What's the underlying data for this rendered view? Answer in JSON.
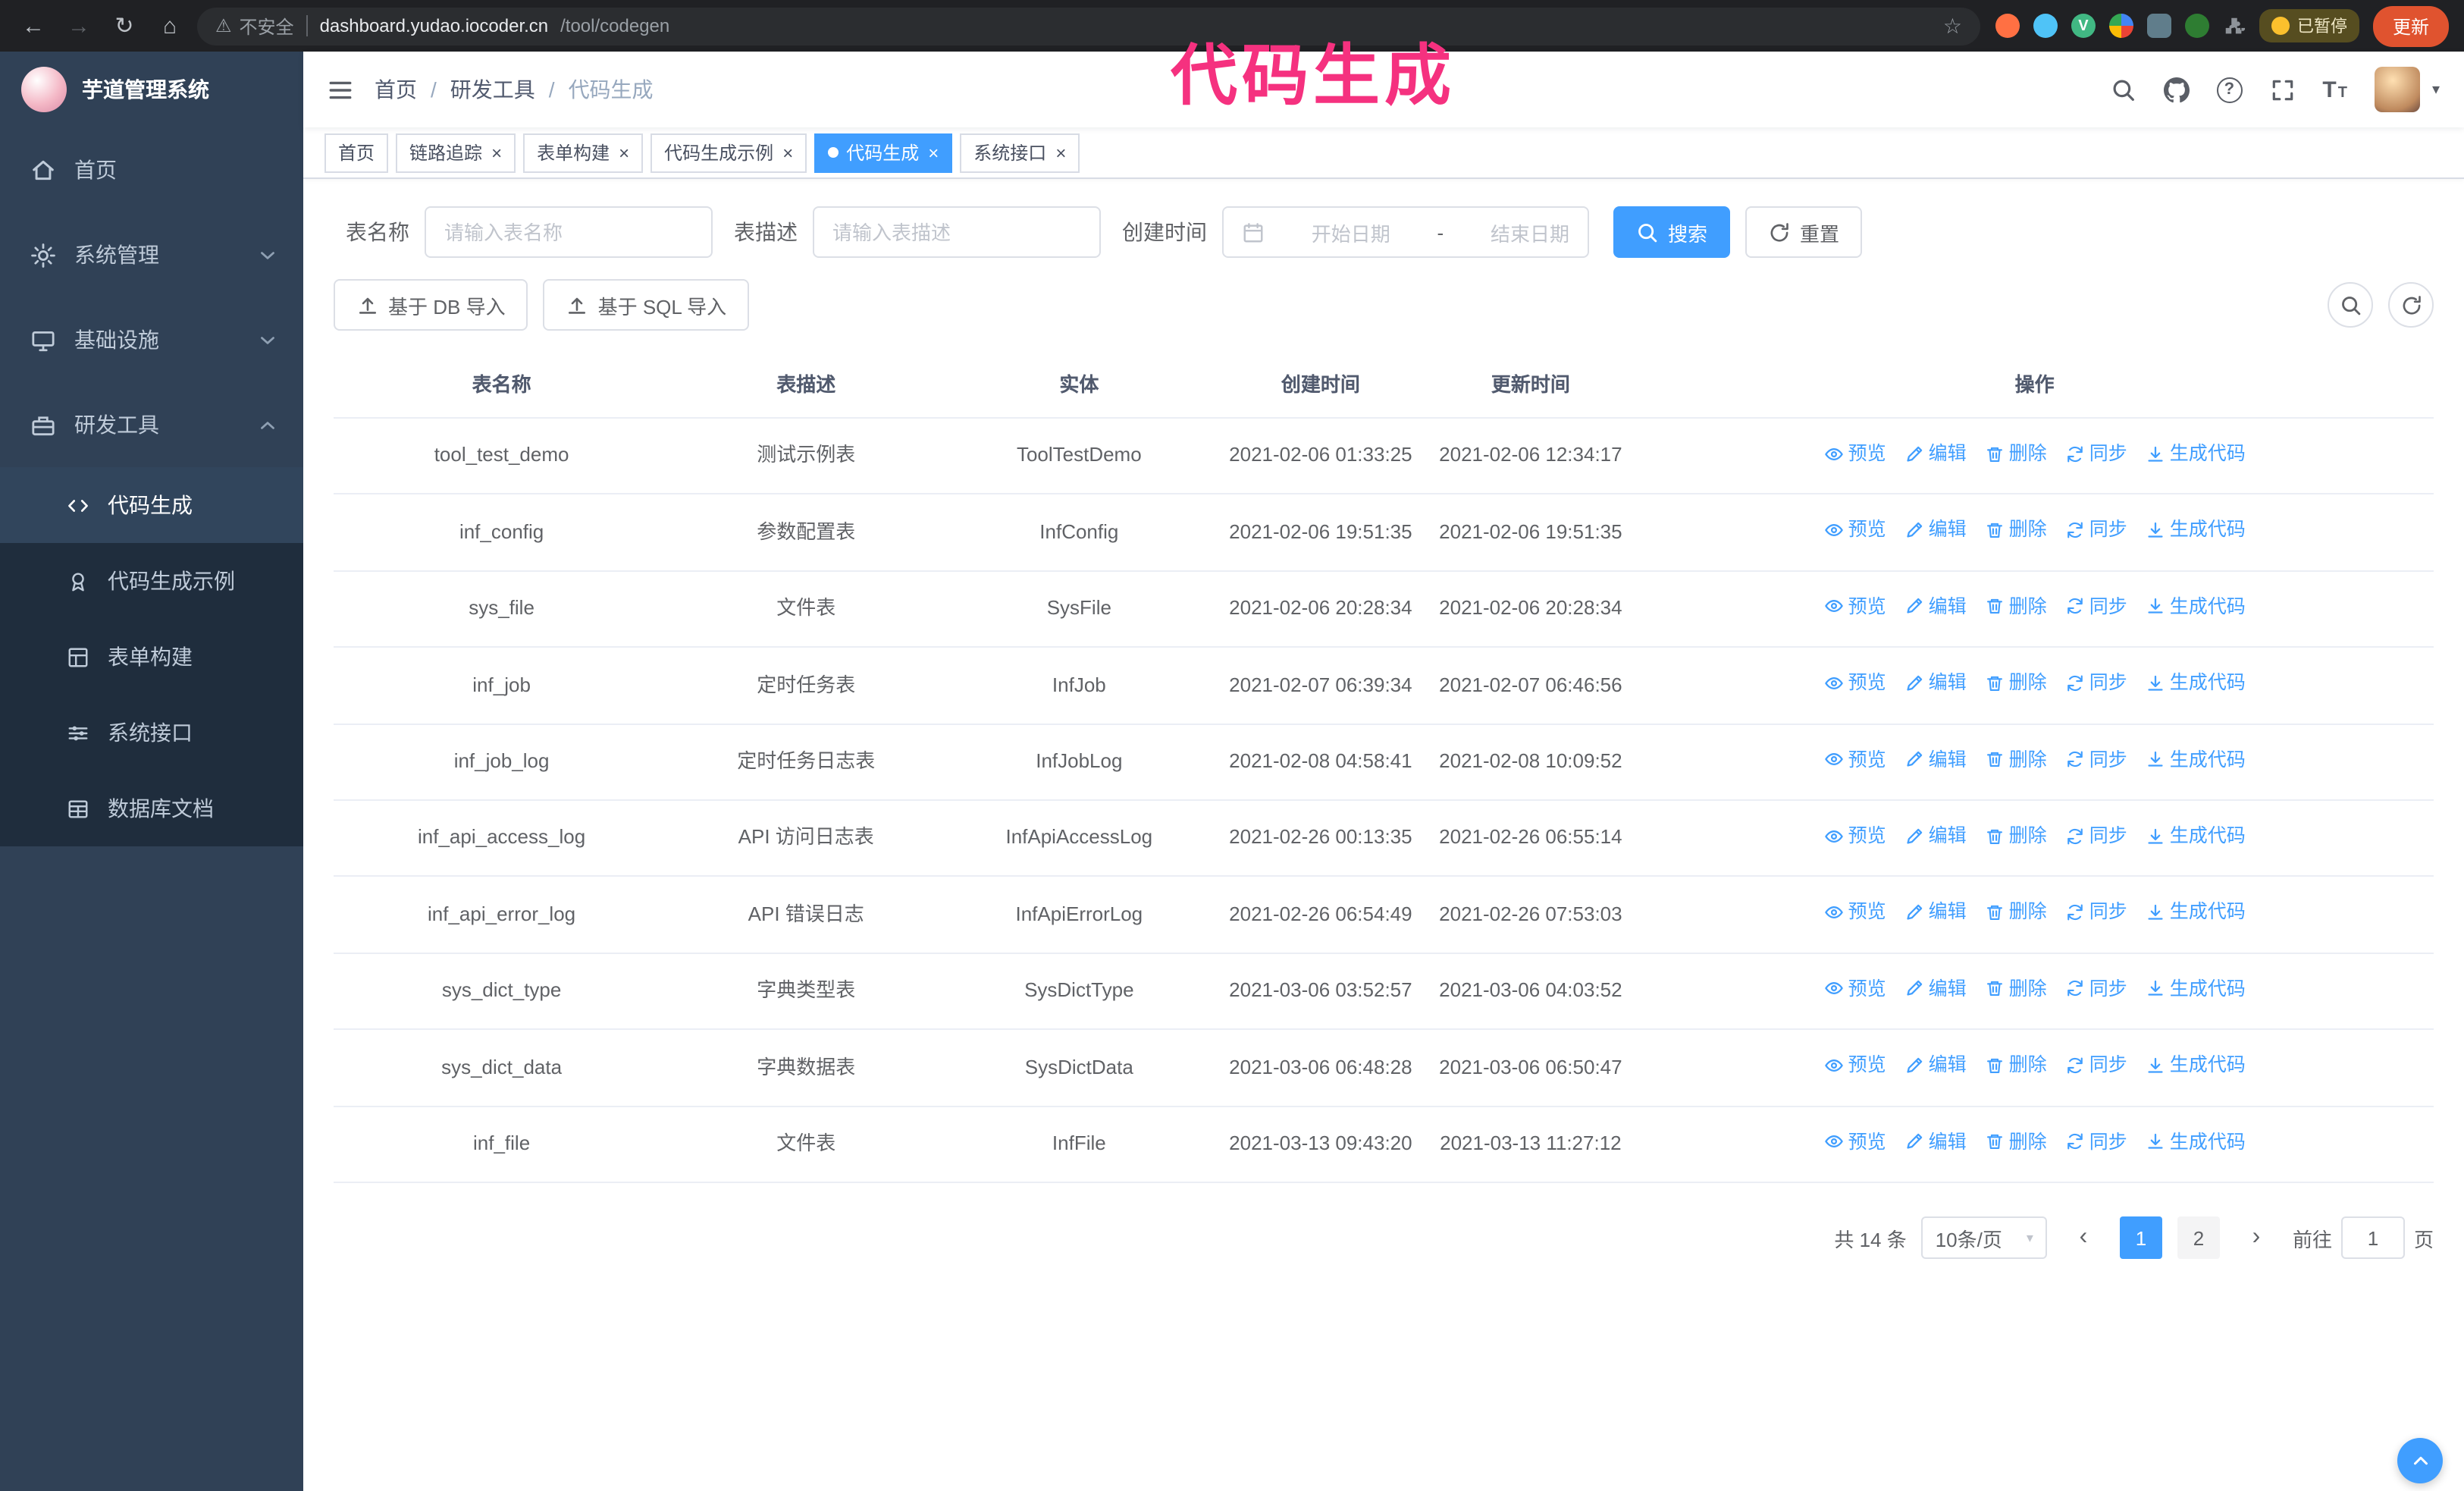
{
  "colors": {
    "accent": "#409eff",
    "annotation": "#f5317f",
    "sidebar_bg": "#304156",
    "submenu_bg": "#1f2d3d",
    "update_btn": "#e0532f"
  },
  "icons": {
    "back": "←",
    "forward": "→",
    "reload": "↻",
    "home": "⌂",
    "warning": "⚠",
    "star": "☆",
    "close": "×",
    "caret_down": "▾",
    "slash": "/",
    "prev": "‹",
    "next": "›",
    "text": "T",
    "question": "?"
  },
  "annotation": {
    "text": "代码生成"
  },
  "browser": {
    "warning": "不安全",
    "url_host": "dashboard.yudao.iocoder.cn",
    "url_path": "/tool/codegen",
    "vue_badge": "V",
    "paused_badge": "已暂停",
    "update_button": "更新"
  },
  "sidebar": {
    "title": "芋道管理系统",
    "menu": [
      {
        "label": "首页"
      },
      {
        "label": "系统管理"
      },
      {
        "label": "基础设施"
      },
      {
        "label": "研发工具"
      }
    ],
    "submenu": [
      {
        "label": "代码生成"
      },
      {
        "label": "代码生成示例"
      },
      {
        "label": "表单构建"
      },
      {
        "label": "系统接口"
      },
      {
        "label": "数据库文档"
      }
    ]
  },
  "header": {
    "breadcrumb": [
      "首页",
      "研发工具",
      "代码生成"
    ]
  },
  "tabs": [
    {
      "label": "首页"
    },
    {
      "label": "链路追踪"
    },
    {
      "label": "表单构建"
    },
    {
      "label": "代码生成示例"
    },
    {
      "label": "代码生成"
    },
    {
      "label": "系统接口"
    }
  ],
  "filters": {
    "table_name_label": "表名称",
    "table_name_placeholder": "请输入表名称",
    "table_desc_label": "表描述",
    "table_desc_placeholder": "请输入表描述",
    "create_time_label": "创建时间",
    "start_placeholder": "开始日期",
    "range_separator": "-",
    "end_placeholder": "结束日期",
    "search_button": "搜索",
    "reset_button": "重置"
  },
  "toolbar": {
    "import_db_button": "基于 DB 导入",
    "import_sql_button": "基于 SQL 导入"
  },
  "table": {
    "columns": [
      "表名称",
      "表描述",
      "实体",
      "创建时间",
      "更新时间",
      "操作"
    ],
    "actions": [
      "预览",
      "编辑",
      "删除",
      "同步",
      "生成代码"
    ],
    "rows": [
      {
        "name": "tool_test_demo",
        "desc": "测试示例表",
        "entity": "ToolTestDemo",
        "created": "2021-02-06 01:33:25",
        "updated": "2021-02-06 12:34:17"
      },
      {
        "name": "inf_config",
        "desc": "参数配置表",
        "entity": "InfConfig",
        "created": "2021-02-06 19:51:35",
        "updated": "2021-02-06 19:51:35"
      },
      {
        "name": "sys_file",
        "desc": "文件表",
        "entity": "SysFile",
        "created": "2021-02-06 20:28:34",
        "updated": "2021-02-06 20:28:34"
      },
      {
        "name": "inf_job",
        "desc": "定时任务表",
        "entity": "InfJob",
        "created": "2021-02-07 06:39:34",
        "updated": "2021-02-07 06:46:56"
      },
      {
        "name": "inf_job_log",
        "desc": "定时任务日志表",
        "entity": "InfJobLog",
        "created": "2021-02-08 04:58:41",
        "updated": "2021-02-08 10:09:52"
      },
      {
        "name": "inf_api_access_log",
        "desc": "API 访问日志表",
        "entity": "InfApiAccessLog",
        "created": "2021-02-26 00:13:35",
        "updated": "2021-02-26 06:55:14"
      },
      {
        "name": "inf_api_error_log",
        "desc": "API 错误日志",
        "entity": "InfApiErrorLog",
        "created": "2021-02-26 06:54:49",
        "updated": "2021-02-26 07:53:03"
      },
      {
        "name": "sys_dict_type",
        "desc": "字典类型表",
        "entity": "SysDictType",
        "created": "2021-03-06 03:52:57",
        "updated": "2021-03-06 04:03:52"
      },
      {
        "name": "sys_dict_data",
        "desc": "字典数据表",
        "entity": "SysDictData",
        "created": "2021-03-06 06:48:28",
        "updated": "2021-03-06 06:50:47"
      },
      {
        "name": "inf_file",
        "desc": "文件表",
        "entity": "InfFile",
        "created": "2021-03-13 09:43:20",
        "updated": "2021-03-13 11:27:12"
      }
    ]
  },
  "pagination": {
    "total": "共 14 条",
    "page_size": "10条/页",
    "pages": [
      "1",
      "2"
    ],
    "goto_label": "前往",
    "goto_value": "1",
    "goto_unit": "页"
  }
}
